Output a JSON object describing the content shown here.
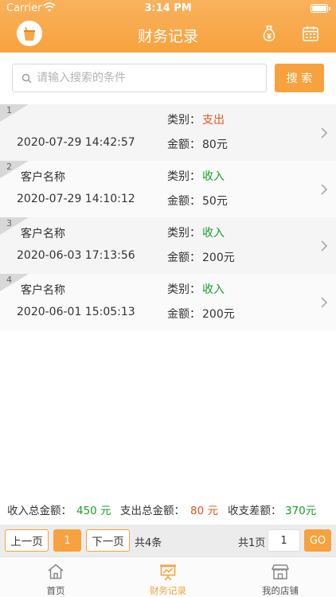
{
  "status_bar": {
    "carrier": "Carrier",
    "time": "3:14 PM"
  },
  "header": {
    "title": "财务记录",
    "icons": [
      "shop-logo-icon",
      "money-bag-icon",
      "calendar-icon"
    ]
  },
  "search": {
    "placeholder": "请输入搜索的条件",
    "value": "",
    "button_label": "搜 索"
  },
  "labels": {
    "category": "类别：",
    "amount": "金额："
  },
  "records": [
    {
      "index": "1",
      "customer": "",
      "time": "2020-07-29 14:42:57",
      "category": "支出",
      "amount": "80元"
    },
    {
      "index": "2",
      "customer": "客户名称",
      "time": "2020-07-29 14:10:12",
      "category": "收入",
      "amount": "50元"
    },
    {
      "index": "3",
      "customer": "客户名称",
      "time": "2020-06-03 17:13:56",
      "category": "收入",
      "amount": "200元"
    },
    {
      "index": "4",
      "customer": "客户名称",
      "time": "2020-06-01 15:05:13",
      "category": "收入",
      "amount": "200元"
    }
  ],
  "summary": {
    "income_label": "收入总金额：",
    "income_value": "450 元",
    "expense_label": "支出总金额：",
    "expense_value": "80 元",
    "diff_label": "收支差额：",
    "diff_value": "370元"
  },
  "pagination": {
    "prev_label": "上一页",
    "current_page": "1",
    "next_label": "下一页",
    "total_items": "共4条",
    "total_pages": "共1页",
    "goto_value": "1",
    "go_label": "GO"
  },
  "tabbar": {
    "items": [
      {
        "label": "首页",
        "icon": "home-icon"
      },
      {
        "label": "财务记录",
        "icon": "finance-board-icon",
        "active": true
      },
      {
        "label": "我的店铺",
        "icon": "store-icon"
      }
    ]
  },
  "colors": {
    "accent": "#f7a23e",
    "income": "#1a9c2b",
    "expense": "#e8541e"
  }
}
